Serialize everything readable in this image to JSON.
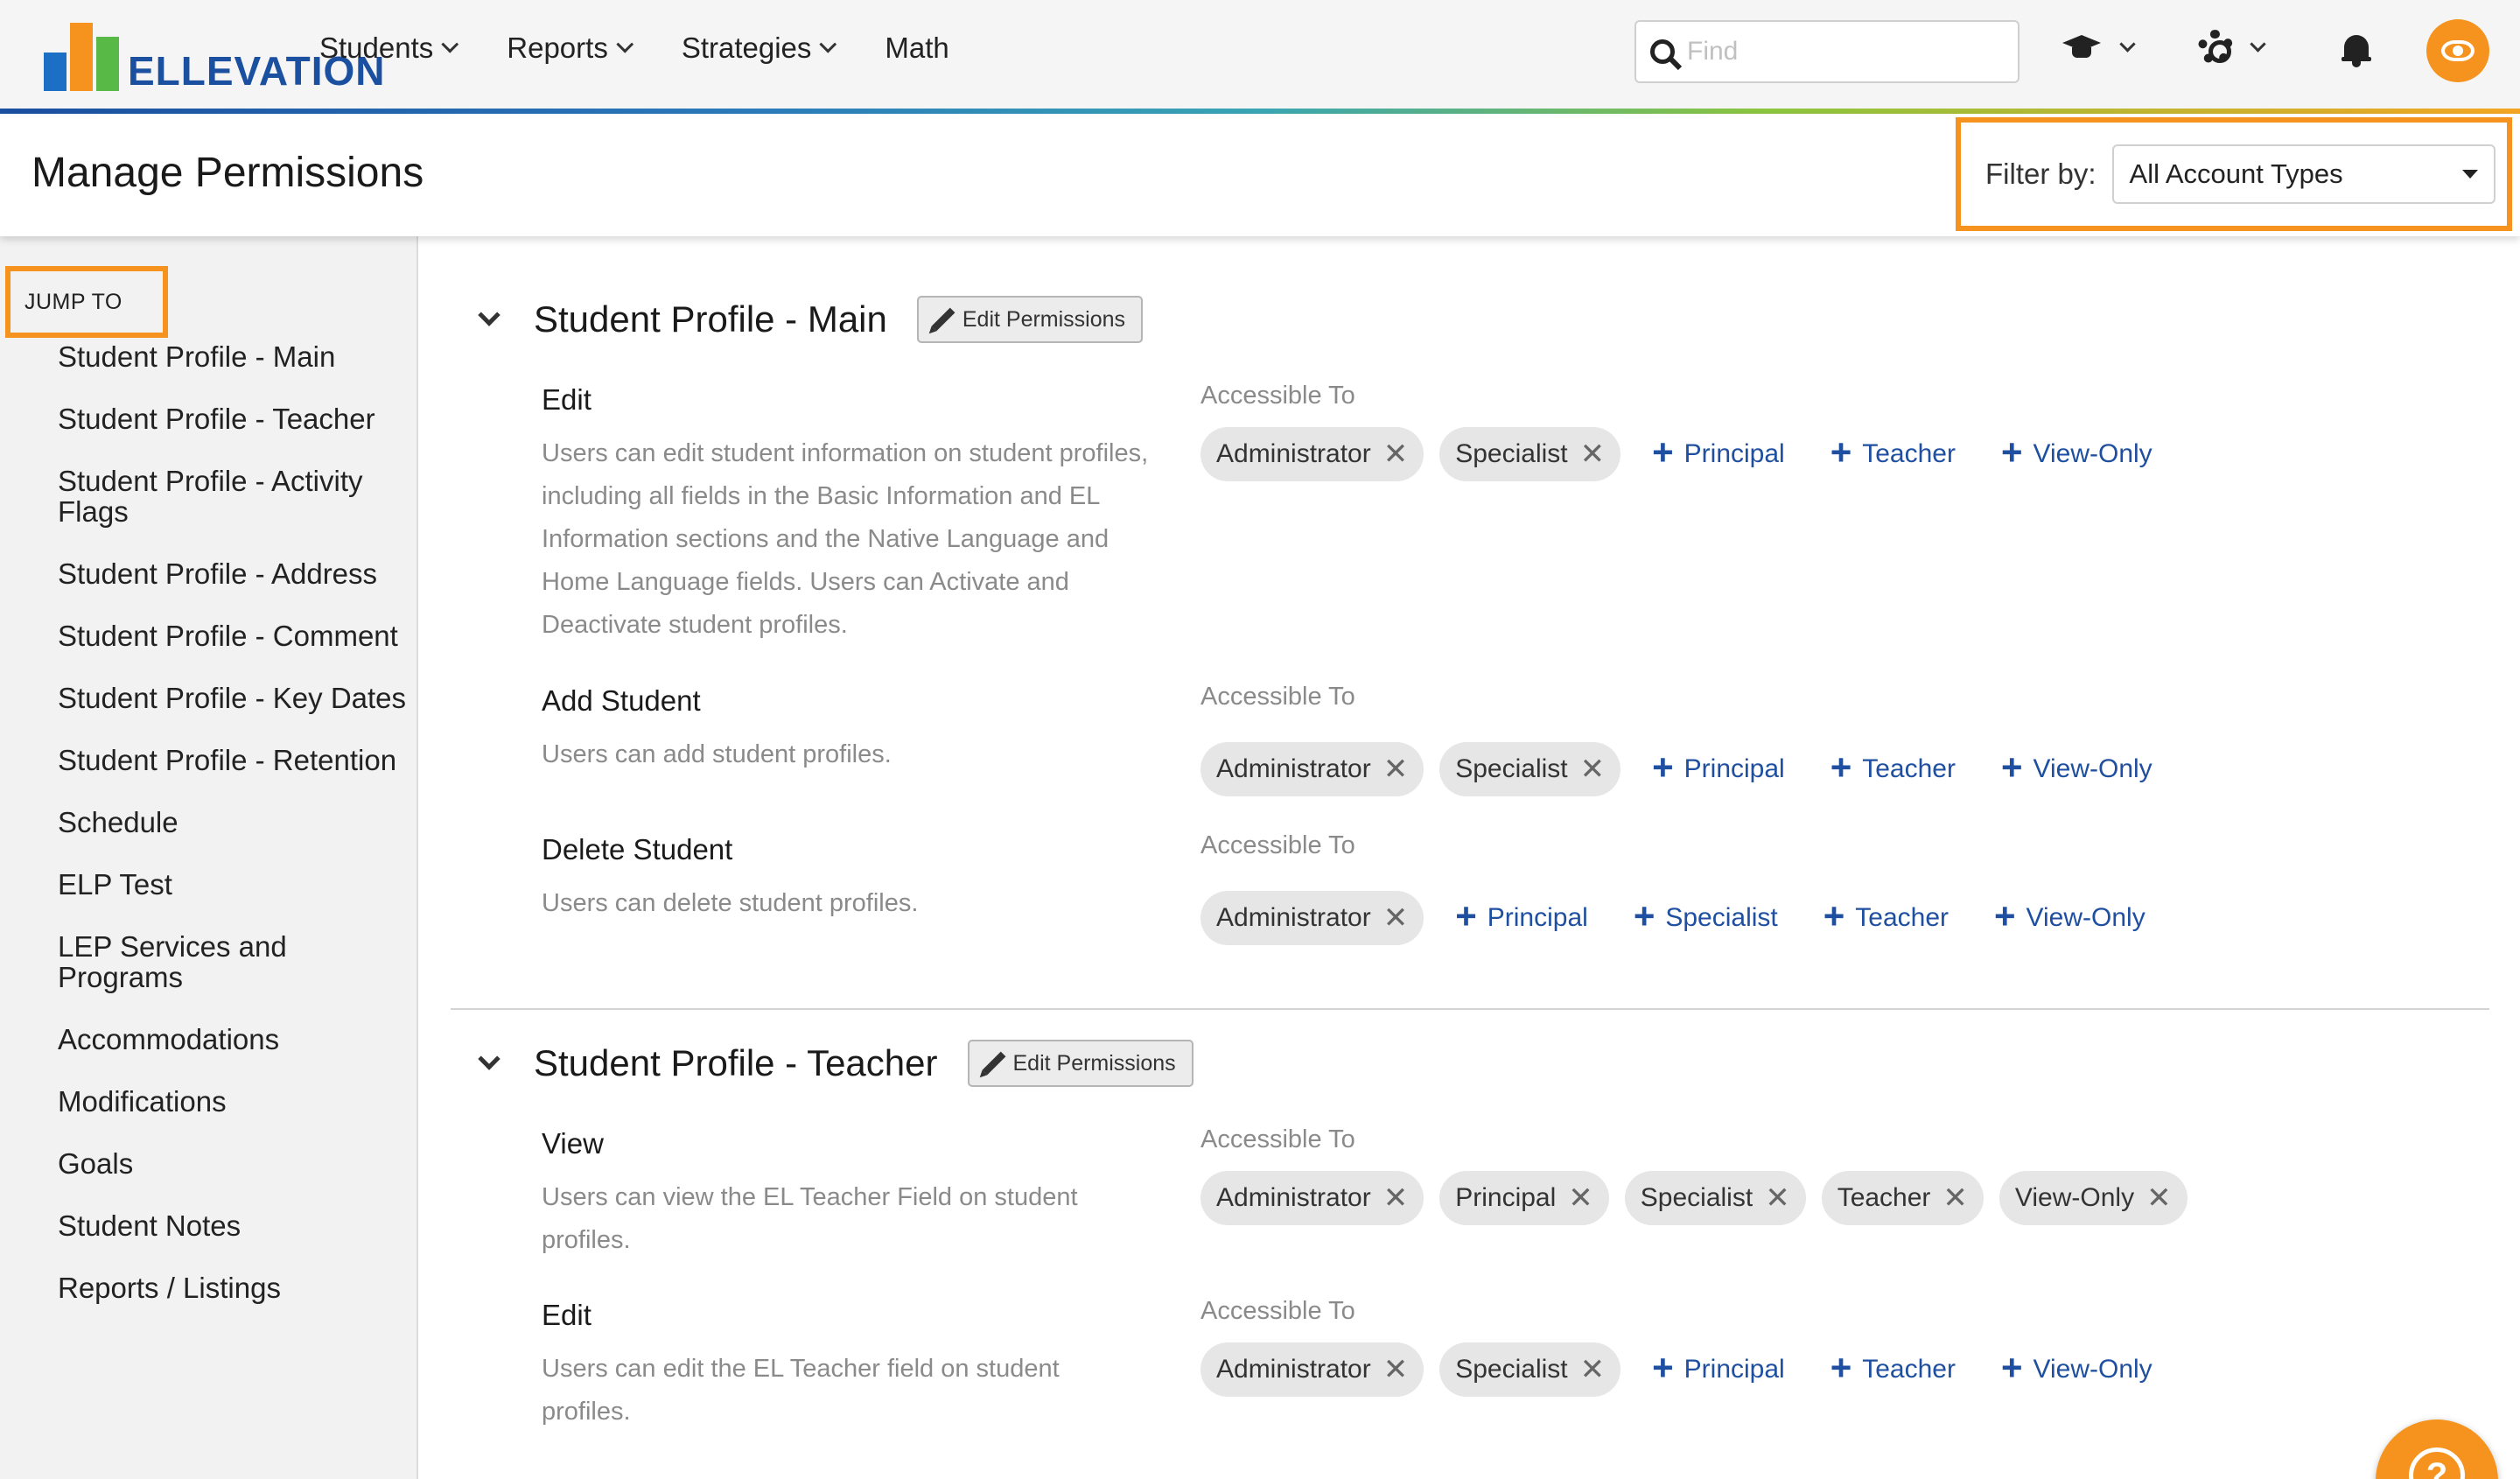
{
  "nav": {
    "logo": "ELLEVATION",
    "items": [
      {
        "label": "Students",
        "dropdown": true
      },
      {
        "label": "Reports",
        "dropdown": true
      },
      {
        "label": "Strategies",
        "dropdown": true
      },
      {
        "label": "Math",
        "dropdown": false
      }
    ],
    "search_placeholder": "Find",
    "icons": [
      "graduation-cap-icon",
      "gear-icon",
      "bell-icon",
      "eye-icon"
    ]
  },
  "header": {
    "title": "Manage Permissions",
    "filter_label": "Filter by:",
    "filter_value": "All Account Types"
  },
  "sidebar": {
    "jump_to": "JUMP TO",
    "items": [
      "Student Profile - Main",
      "Student Profile - Teacher",
      "Student Profile - Activity Flags",
      "Student Profile - Address",
      "Student Profile - Comment",
      "Student Profile - Key Dates",
      "Student Profile - Retention",
      "Schedule",
      "ELP Test",
      "LEP Services and Programs",
      "Accommodations",
      "Modifications",
      "Goals",
      "Student Notes",
      "Reports / Listings"
    ]
  },
  "edit_permissions_label": "Edit Permissions",
  "accessible_to_label": "Accessible To",
  "sections": [
    {
      "title": "Student Profile - Main",
      "permissions": [
        {
          "name": "Edit",
          "description": "Users can edit student information on student profiles, including all fields in the Basic Information and EL Information sections and the Native Language and Home Language fields. Users can Activate and Deactivate student profiles.",
          "granted": [
            "Administrator",
            "Specialist"
          ],
          "available": [
            "Principal",
            "Teacher",
            "View-Only"
          ]
        },
        {
          "name": "Add Student",
          "description": "Users can add student profiles.",
          "granted": [
            "Administrator",
            "Specialist"
          ],
          "available": [
            "Principal",
            "Teacher",
            "View-Only"
          ]
        },
        {
          "name": "Delete Student",
          "description": "Users can delete student profiles.",
          "granted": [
            "Administrator"
          ],
          "available": [
            "Principal",
            "Specialist",
            "Teacher",
            "View-Only"
          ]
        }
      ]
    },
    {
      "title": "Student Profile - Teacher",
      "permissions": [
        {
          "name": "View",
          "description": "Users can view the EL Teacher Field on student profiles.",
          "granted": [
            "Administrator",
            "Principal",
            "Specialist",
            "Teacher",
            "View-Only"
          ],
          "available": []
        },
        {
          "name": "Edit",
          "description": "Users can edit the EL Teacher field on student profiles.",
          "granted": [
            "Administrator",
            "Specialist"
          ],
          "available": [
            "Principal",
            "Teacher",
            "View-Only"
          ]
        }
      ]
    }
  ],
  "help_button": "?"
}
